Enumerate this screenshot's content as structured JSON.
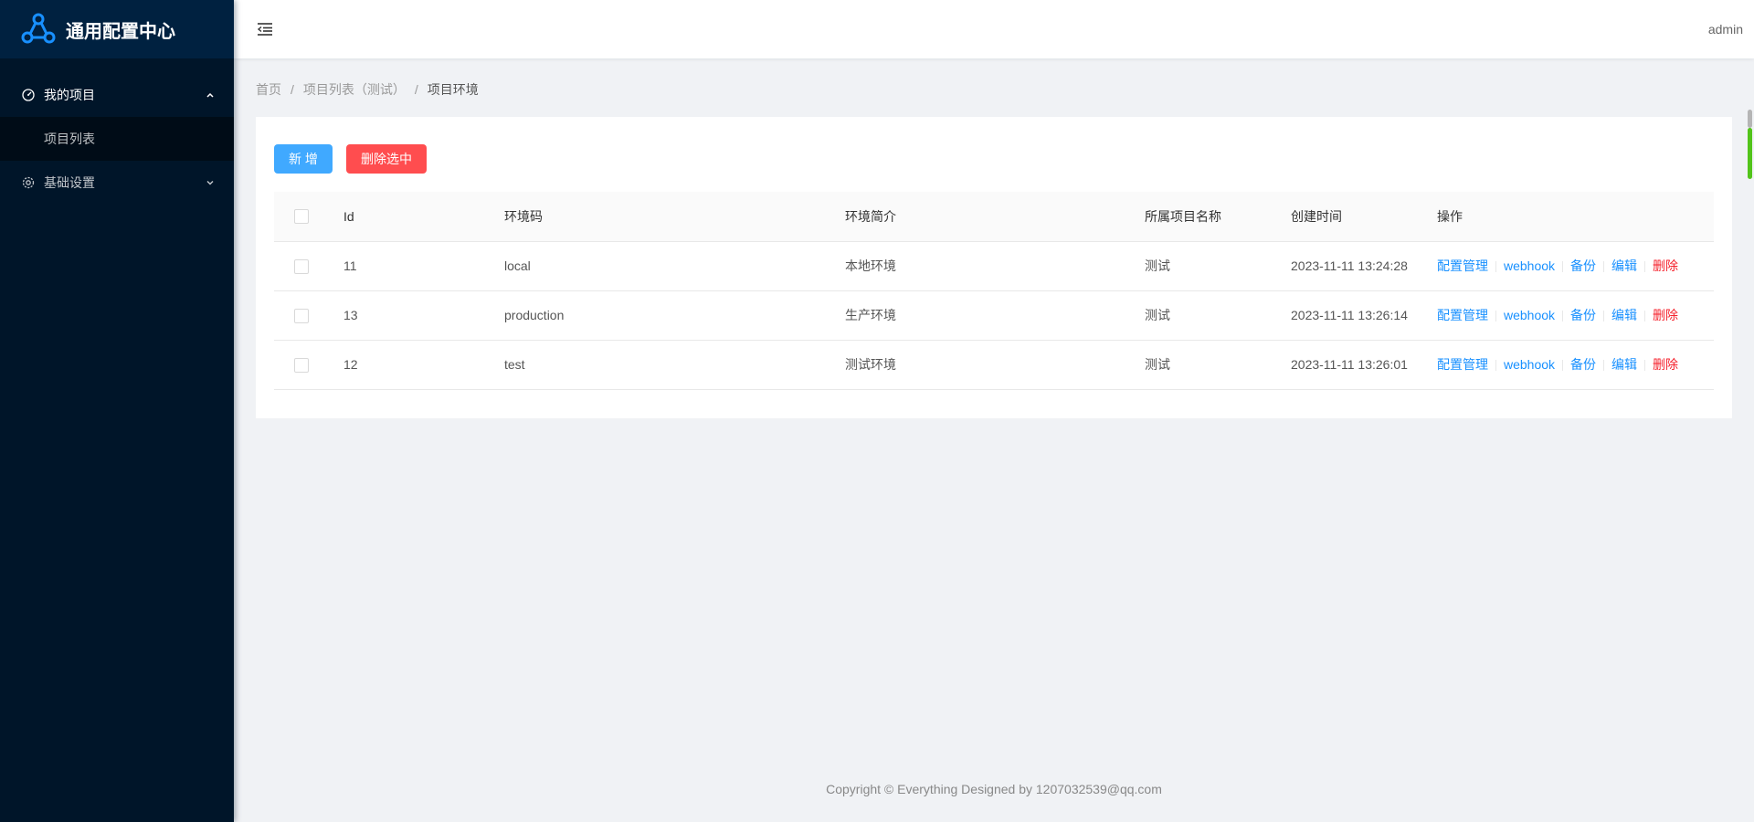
{
  "app": {
    "title": "通用配置中心"
  },
  "sidebar": {
    "items": [
      {
        "label": "我的项目",
        "icon": "dashboard-icon",
        "open": true,
        "children": [
          {
            "label": "项目列表"
          }
        ]
      },
      {
        "label": "基础设置",
        "icon": "gear-icon",
        "open": false
      }
    ]
  },
  "header": {
    "user": "admin"
  },
  "breadcrumb": {
    "items": [
      "首页",
      "项目列表（测试）",
      "项目环境"
    ],
    "separator": "/"
  },
  "toolbar": {
    "add_label": "新 增",
    "delete_selected_label": "删除选中"
  },
  "table": {
    "columns": [
      "Id",
      "环境码",
      "环境简介",
      "所属项目名称",
      "创建时间",
      "操作"
    ],
    "rows": [
      {
        "id": "11",
        "code": "local",
        "desc": "本地环境",
        "project": "测试",
        "created": "2023-11-11 13:24:28"
      },
      {
        "id": "13",
        "code": "production",
        "desc": "生产环境",
        "project": "测试",
        "created": "2023-11-11 13:26:14"
      },
      {
        "id": "12",
        "code": "test",
        "desc": "测试环境",
        "project": "测试",
        "created": "2023-11-11 13:26:01"
      }
    ],
    "actions": [
      "配置管理",
      "webhook",
      "备份",
      "编辑",
      "删除"
    ]
  },
  "footer": {
    "text": "Copyright © Everything Designed by 1207032539@qq.com"
  },
  "colors": {
    "sidebar_bg": "#001529",
    "primary": "#1890ff",
    "danger": "#ff4d4f",
    "add_button": "#40a9ff"
  }
}
